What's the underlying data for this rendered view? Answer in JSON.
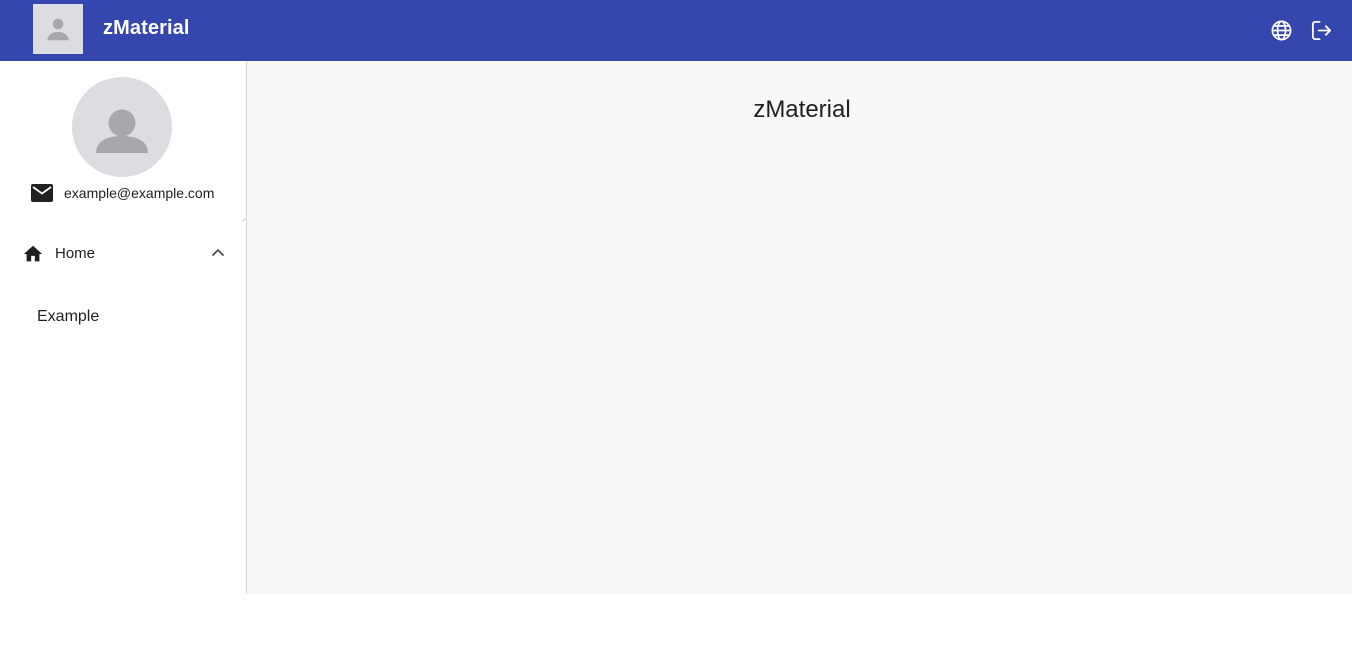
{
  "header": {
    "app_title": "zMaterial",
    "accent_color": "#3546ae",
    "icons": [
      "person-icon",
      "globe-icon",
      "logout-icon"
    ]
  },
  "sidebar": {
    "email": "example@example.com",
    "nav": [
      {
        "label": "Home",
        "icon": "home-icon",
        "expanded": true,
        "children": [
          {
            "label": "Example"
          }
        ]
      }
    ]
  },
  "main": {
    "title": "zMaterial"
  }
}
